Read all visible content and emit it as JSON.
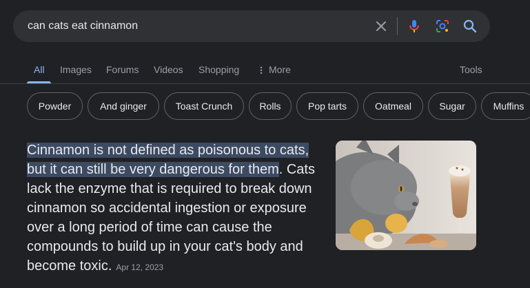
{
  "search": {
    "query": "can cats eat cinnamon",
    "icons": [
      "close-icon",
      "microphone-icon",
      "lens-icon",
      "search-icon"
    ]
  },
  "tabs": [
    {
      "label": "All",
      "active": true
    },
    {
      "label": "Images"
    },
    {
      "label": "Forums"
    },
    {
      "label": "Videos"
    },
    {
      "label": "Shopping"
    },
    {
      "label": "More"
    }
  ],
  "tools_label": "Tools",
  "chips": [
    "Powder",
    "And ginger",
    "Toast Crunch",
    "Rolls",
    "Pop tarts",
    "Oatmeal",
    "Sugar",
    "Muffins"
  ],
  "snippet": {
    "highlighted": "Cinnamon is not defined as poisonous to cats, but it can still be very dangerous for them",
    "rest": ". Cats lack the enzyme that is required to break down cinnamon so accidental ingestion or exposure over a long period of time can cause the compounds to build up in your cat's body and become toxic.",
    "date": "Apr 12, 2023"
  },
  "colors": {
    "background": "#202124",
    "accent": "#8ab4f8",
    "highlight": "#3c4a62"
  }
}
